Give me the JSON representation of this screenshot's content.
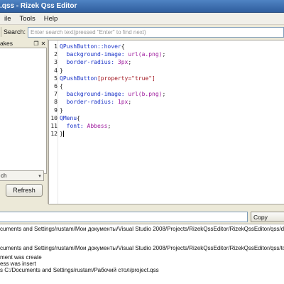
{
  "window": {
    "title": ".qss - Rizek Qss Editor"
  },
  "menu": {
    "items": [
      "ile",
      "Tools",
      "Help"
    ]
  },
  "toolbar": {
    "search_label": "Search:",
    "search_placeholder": "Enter search text(pressed \"Enter\" to find next)",
    "search_value": ""
  },
  "left_panel": {
    "title": "akes",
    "float_icon": "float-icon",
    "close_icon": "close-icon",
    "combo_value": "ch",
    "refresh_label": "Refresh"
  },
  "editor": {
    "lines": [
      {
        "n": "1",
        "parts": [
          [
            "sel",
            "QPushButton::hover"
          ],
          [
            "brace",
            "{"
          ]
        ]
      },
      {
        "n": "2",
        "parts": [
          [
            "prop",
            "  background-image: "
          ],
          [
            "val",
            "url(a.png)"
          ],
          [
            "brace",
            ";"
          ]
        ]
      },
      {
        "n": "3",
        "parts": [
          [
            "prop",
            "  border-radius: "
          ],
          [
            "val",
            "3px"
          ],
          [
            "brace",
            ";"
          ]
        ]
      },
      {
        "n": "4",
        "parts": [
          [
            "brace",
            "}"
          ]
        ]
      },
      {
        "n": "5",
        "parts": [
          [
            "sel",
            "QPushButton"
          ],
          [
            "attr",
            "[property=\"true\"]"
          ]
        ]
      },
      {
        "n": "6",
        "parts": [
          [
            "brace",
            "{"
          ]
        ]
      },
      {
        "n": "7",
        "parts": [
          [
            "prop",
            "  background-image: "
          ],
          [
            "val",
            "url(b.png)"
          ],
          [
            "brace",
            ";"
          ]
        ]
      },
      {
        "n": "8",
        "parts": [
          [
            "prop",
            "  border-radius: "
          ],
          [
            "val",
            "1px"
          ],
          [
            "brace",
            ";"
          ]
        ]
      },
      {
        "n": "9",
        "parts": [
          [
            "brace",
            "}"
          ]
        ]
      },
      {
        "n": "10",
        "parts": [
          [
            "sel",
            "QMenu"
          ],
          [
            "brace",
            "{"
          ]
        ]
      },
      {
        "n": "11",
        "parts": [
          [
            "prop",
            "  font: "
          ],
          [
            "val",
            "Abbess"
          ],
          [
            "brace",
            ";"
          ]
        ]
      },
      {
        "n": "12",
        "parts": [
          [
            "brace",
            "}"
          ]
        ]
      }
    ]
  },
  "bottom": {
    "command_value": "",
    "copy_label": "Copy",
    "log_lines": [
      "cuments and Settings/rustam/Мои документы/Visual Studio 2008/Projects/RizekQssEditor/RizekQssEditor/qss/default.qss",
      "cuments and Settings/rustam/Мои документы/Visual Studio 2008/Projects/RizekQssEditor/RizekQssEditor/qss/toolBar.qss",
      "ment was create",
      "ess was insert",
      "s C:/Documents and Settings/rustam/Рабочий стол/project.qss"
    ]
  },
  "colors": {
    "titlebar": "#3a6bb0",
    "selector": "#1a33c8",
    "value": "#9e1a9e",
    "attribute": "#a0141e"
  }
}
